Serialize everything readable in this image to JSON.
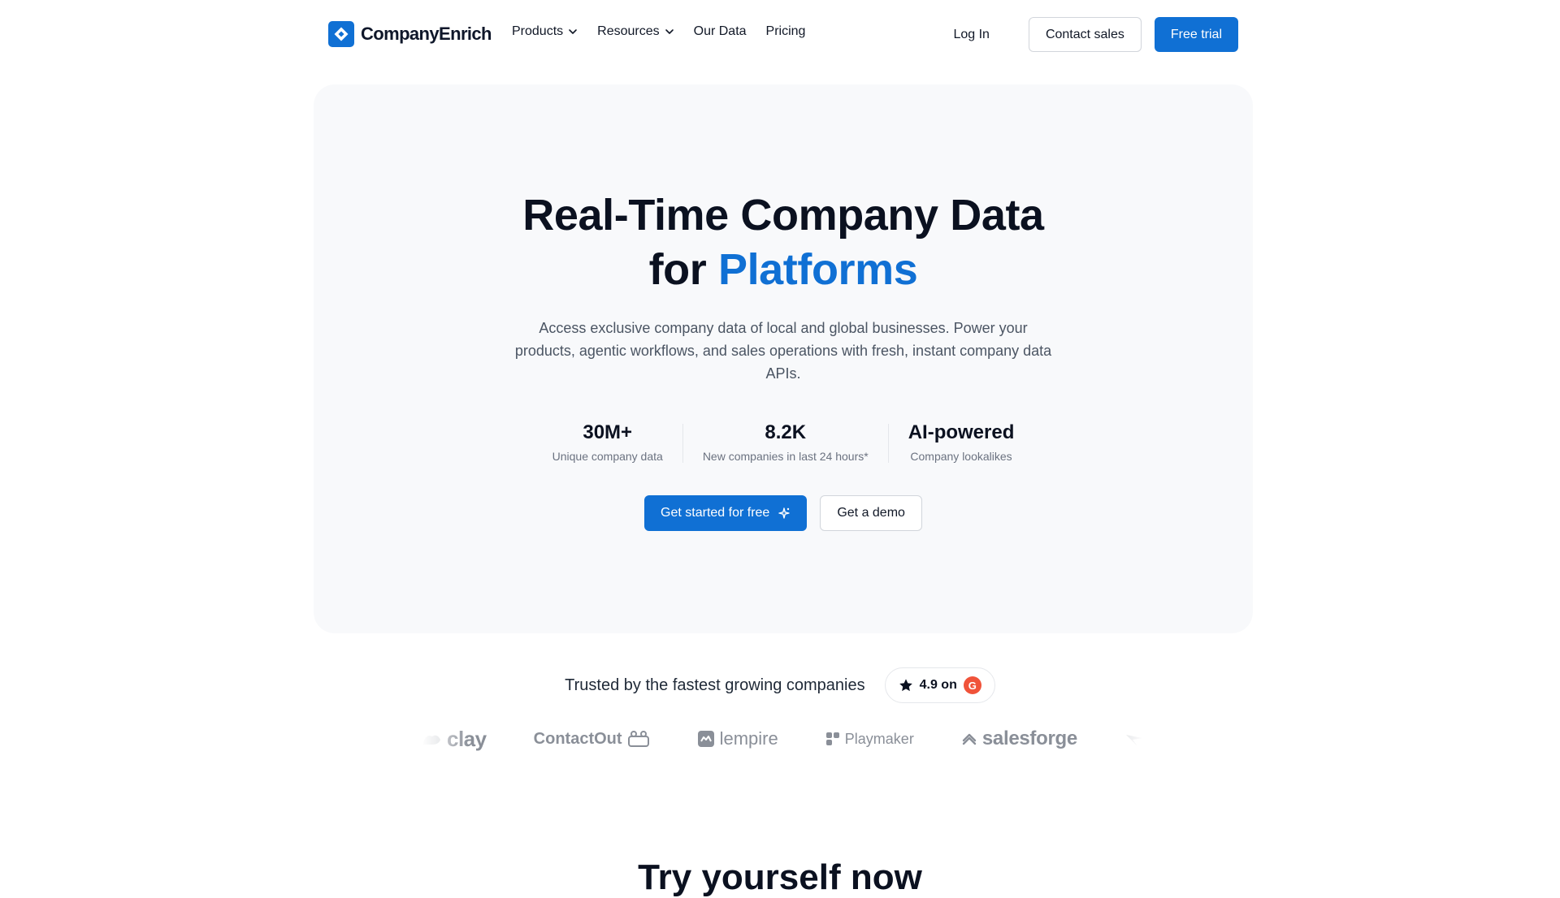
{
  "nav": {
    "brand": "CompanyEnrich",
    "links": [
      {
        "label": "Products",
        "has_dropdown": true
      },
      {
        "label": "Resources",
        "has_dropdown": true
      },
      {
        "label": "Our Data",
        "has_dropdown": false
      },
      {
        "label": "Pricing",
        "has_dropdown": false
      }
    ],
    "login": "Log In",
    "contact_sales": "Contact sales",
    "free_trial": "Free trial"
  },
  "hero": {
    "title_line1": "Real-Time Company Data",
    "title_line2_prefix": "for ",
    "title_accent": "Platforms",
    "subtitle": "Access exclusive company data of local and global businesses. Power your products, agentic workflows, and sales operations with fresh, instant company data APIs.",
    "stats": [
      {
        "value": "30M+",
        "label": "Unique company data"
      },
      {
        "value": "8.2K",
        "label": "New companies in last 24 hours*"
      },
      {
        "value": "AI-powered",
        "label": "Company lookalikes"
      }
    ],
    "cta_primary": "Get started for free",
    "cta_secondary": "Get a demo"
  },
  "trust": {
    "text": "Trusted by the fastest growing companies",
    "rating": "4.9 on",
    "g2": "G"
  },
  "logos": [
    "clay",
    "ContactOut",
    "lempire",
    "Playmaker",
    "salesforge"
  ],
  "bottom": {
    "title": "Try yourself now"
  },
  "colors": {
    "accent": "#1070d4",
    "hero_bg": "#f8f9fb",
    "g2": "#f0533a"
  }
}
